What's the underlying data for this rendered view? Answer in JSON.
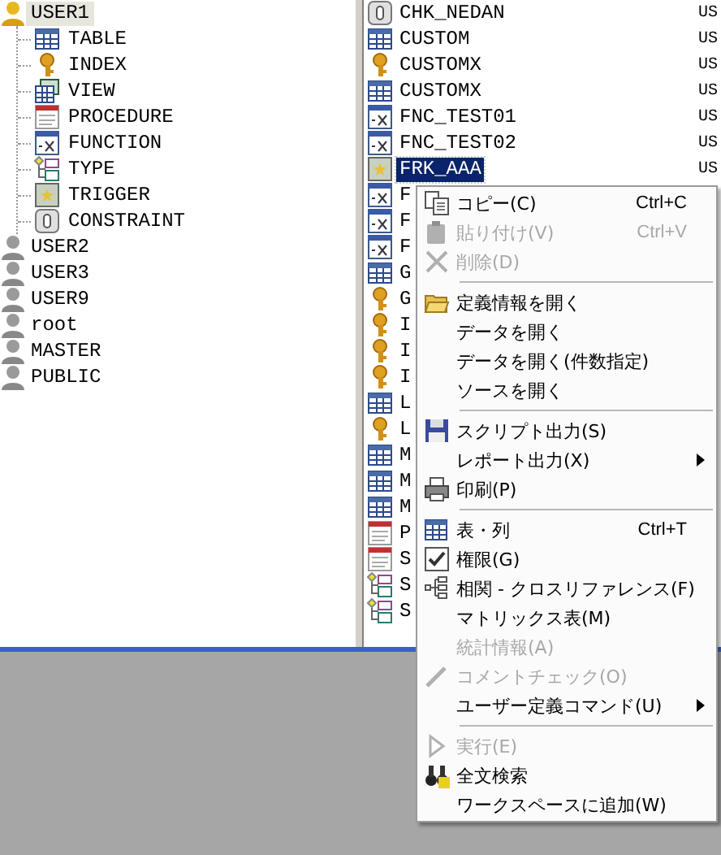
{
  "tree": [
    {
      "label": "USER1",
      "selected": true,
      "children": [
        {
          "label": "TABLE"
        },
        {
          "label": "INDEX"
        },
        {
          "label": "VIEW"
        },
        {
          "label": "PROCEDURE"
        },
        {
          "label": "FUNCTION"
        },
        {
          "label": "TYPE"
        },
        {
          "label": "TRIGGER"
        },
        {
          "label": "CONSTRAINT"
        }
      ]
    },
    {
      "label": "USER2",
      "selected": false
    },
    {
      "label": "USER3",
      "selected": false
    },
    {
      "label": "USER9",
      "selected": false
    },
    {
      "label": "root",
      "selected": false
    },
    {
      "label": "MASTER",
      "selected": false
    },
    {
      "label": "PUBLIC",
      "selected": false
    }
  ],
  "list": {
    "rows": [
      {
        "kind": "constraint",
        "name": "CHK_NEDAN",
        "owner": "US",
        "selected": false
      },
      {
        "kind": "table",
        "name": "CUSTOM",
        "owner": "US",
        "selected": false
      },
      {
        "kind": "index",
        "name": "CUSTOMX",
        "owner": "US",
        "selected": false
      },
      {
        "kind": "table",
        "name": "CUSTOMX",
        "owner": "US",
        "selected": false
      },
      {
        "kind": "function",
        "name": "FNC_TEST01",
        "owner": "US",
        "selected": false
      },
      {
        "kind": "function",
        "name": "FNC_TEST02",
        "owner": "US",
        "selected": false
      },
      {
        "kind": "trigger",
        "name": "FRK_AAA",
        "owner": "US",
        "selected": true
      },
      {
        "kind": "function",
        "name": "F",
        "selected": false
      },
      {
        "kind": "function",
        "name": "F",
        "selected": false
      },
      {
        "kind": "function",
        "name": "F",
        "selected": false
      },
      {
        "kind": "table",
        "name": "G",
        "selected": false
      },
      {
        "kind": "index",
        "name": "G",
        "selected": false
      },
      {
        "kind": "index",
        "name": "I",
        "selected": false
      },
      {
        "kind": "index",
        "name": "I",
        "selected": false
      },
      {
        "kind": "index",
        "name": "I",
        "selected": false
      },
      {
        "kind": "table",
        "name": "L",
        "selected": false
      },
      {
        "kind": "index",
        "name": "L",
        "selected": false
      },
      {
        "kind": "table",
        "name": "M",
        "selected": false
      },
      {
        "kind": "table",
        "name": "M",
        "selected": false
      },
      {
        "kind": "table",
        "name": "M",
        "selected": false
      },
      {
        "kind": "procedure",
        "name": "P",
        "selected": false
      },
      {
        "kind": "procedure",
        "name": "S",
        "selected": false
      },
      {
        "kind": "type",
        "name": "S",
        "selected": false
      },
      {
        "kind": "type",
        "name": "S",
        "selected": false
      }
    ]
  },
  "menu": {
    "sections": [
      [
        {
          "label": "コピー(C)",
          "shortcut": "Ctrl+C",
          "disabled": false,
          "submenu": false
        },
        {
          "label": "貼り付け(V)",
          "shortcut": "Ctrl+V",
          "disabled": true,
          "submenu": false
        },
        {
          "label": "削除(D)",
          "disabled": true,
          "submenu": false
        }
      ],
      [
        {
          "label": "定義情報を開く",
          "disabled": false,
          "submenu": false
        },
        {
          "label": "データを開く",
          "disabled": false,
          "submenu": false
        },
        {
          "label": "データを開く(件数指定)",
          "disabled": false,
          "submenu": false
        },
        {
          "label": "ソースを開く",
          "disabled": false,
          "submenu": false
        }
      ],
      [
        {
          "label": "スクリプト出力(S)",
          "disabled": false,
          "submenu": false
        },
        {
          "label": "レポート出力(X)",
          "disabled": false,
          "submenu": true
        },
        {
          "label": "印刷(P)",
          "disabled": false,
          "submenu": false
        }
      ],
      [
        {
          "label": "表・列",
          "shortcut": "Ctrl+T",
          "disabled": false,
          "submenu": false
        },
        {
          "label": "権限(G)",
          "disabled": false,
          "submenu": false
        },
        {
          "label": "相関 - クロスリファレンス(F)",
          "disabled": false,
          "submenu": false
        },
        {
          "label": "マトリックス表(M)",
          "disabled": false,
          "submenu": false
        },
        {
          "label": "統計情報(A)",
          "disabled": true,
          "submenu": false
        },
        {
          "label": "コメントチェック(O)",
          "disabled": true,
          "submenu": false
        },
        {
          "label": "ユーザー定義コマンド(U)",
          "disabled": false,
          "submenu": true
        }
      ],
      [
        {
          "label": "実行(E)",
          "disabled": true,
          "submenu": false
        },
        {
          "label": "全文検索",
          "disabled": false,
          "submenu": false
        },
        {
          "label": "ワークスペースに追加(W)",
          "disabled": false,
          "submenu": false
        }
      ]
    ]
  }
}
